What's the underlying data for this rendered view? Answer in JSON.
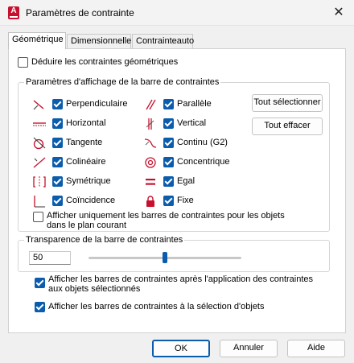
{
  "window": {
    "title": "Paramètres de contrainte",
    "close": "✕"
  },
  "tabs": [
    "Géométrique",
    "Dimensionnelle",
    "Contrainteauto"
  ],
  "infer": {
    "label": "Déduire les contraintes géométriques",
    "checked": false
  },
  "display_group": {
    "title": "Paramètres d'affichage de la barre de contraintes",
    "left": [
      {
        "label": "Perpendiculaire",
        "checked": true,
        "icon": "perpendicular-icon"
      },
      {
        "label": "Horizontal",
        "checked": true,
        "icon": "horizontal-icon"
      },
      {
        "label": "Tangente",
        "checked": true,
        "icon": "tangent-icon"
      },
      {
        "label": "Colinéaire",
        "checked": true,
        "icon": "collinear-icon"
      },
      {
        "label": "Symétrique",
        "checked": true,
        "icon": "symmetric-icon"
      },
      {
        "label": "Coïncidence",
        "checked": true,
        "icon": "coincident-icon"
      }
    ],
    "right": [
      {
        "label": "Parallèle",
        "checked": true,
        "icon": "parallel-icon"
      },
      {
        "label": "Vertical",
        "checked": true,
        "icon": "vertical-icon"
      },
      {
        "label": "Continu (G2)",
        "checked": true,
        "icon": "smooth-icon"
      },
      {
        "label": "Concentrique",
        "checked": true,
        "icon": "concentric-icon"
      },
      {
        "label": "Egal",
        "checked": true,
        "icon": "equal-icon"
      },
      {
        "label": "Fixe",
        "checked": true,
        "icon": "lock-icon"
      }
    ],
    "select_all": "Tout sélectionner",
    "clear_all": "Tout effacer",
    "current_plane": {
      "line1": "Afficher uniquement les barres de contraintes pour les objets",
      "line2": "dans le plan courant",
      "checked": false
    }
  },
  "transparency": {
    "title": "Transparence de la barre de contraintes",
    "value": "50",
    "level_percent": 50
  },
  "show_after_apply": {
    "line1": "Afficher les barres de contraintes après l'application des contraintes",
    "line2": "aux objets sélectionnés",
    "checked": true
  },
  "show_on_select": {
    "label": "Afficher les barres de contraintes à la sélection d'objets",
    "checked": true
  },
  "buttons": {
    "ok": "OK",
    "cancel": "Annuler",
    "help": "Aide"
  },
  "colors": {
    "accent": "#0b5cad",
    "icon_red": "#c8102e"
  }
}
